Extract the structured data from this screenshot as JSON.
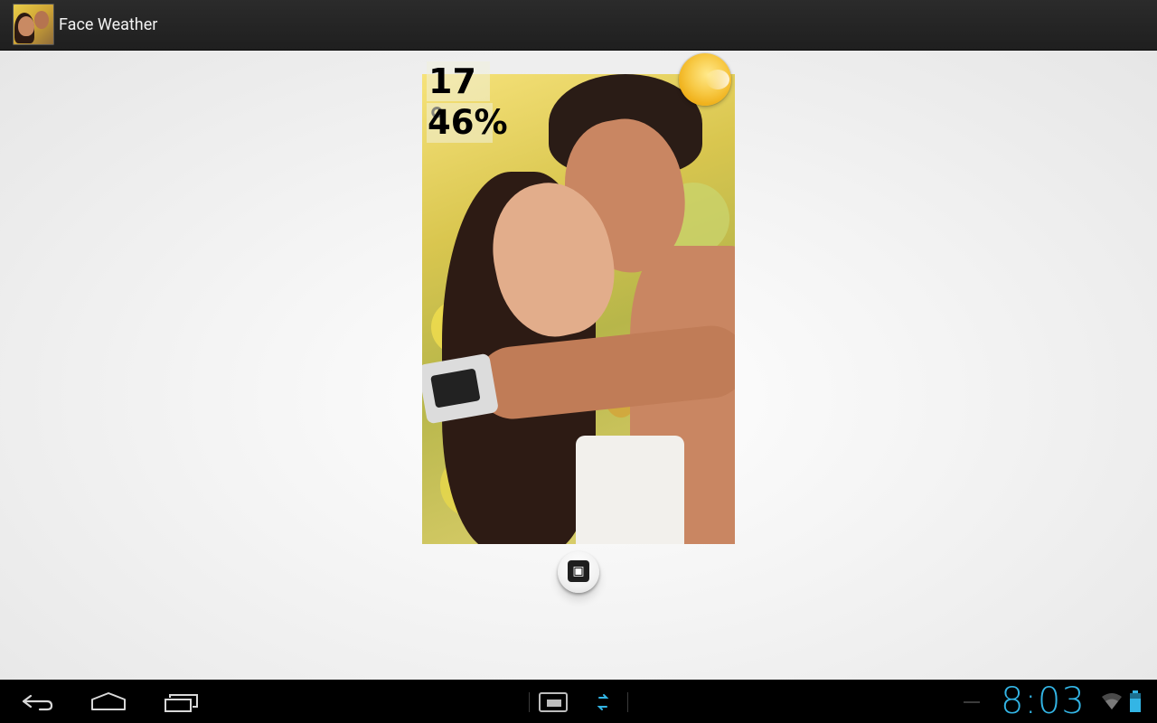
{
  "app": {
    "title": "Face Weather"
  },
  "weather": {
    "temperature": "17 °",
    "humidity": "46%",
    "condition_icon": "sun-icon"
  },
  "share_button": {
    "icon": "photo-share-icon"
  },
  "navigation": {
    "back_icon": "back-icon",
    "home_icon": "home-icon",
    "recent_icon": "recent-apps-icon"
  },
  "status": {
    "time": "8:03",
    "accent_color": "#33b5e5"
  }
}
